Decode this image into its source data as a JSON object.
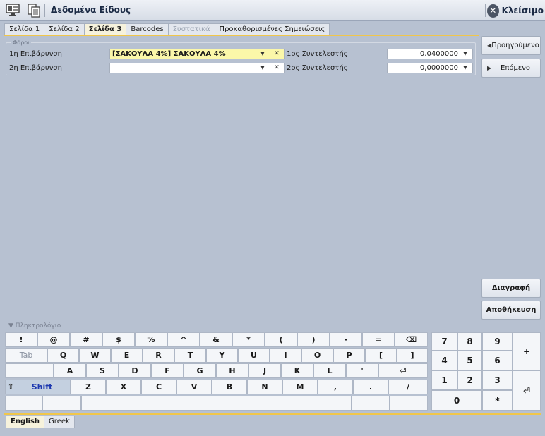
{
  "header": {
    "title": "Δεδομένα Είδους",
    "close_label": "Κλείσιμο"
  },
  "tabs": [
    {
      "label": "Σελίδα 1",
      "active": false,
      "disabled": false
    },
    {
      "label": "Σελίδα 2",
      "active": false,
      "disabled": false
    },
    {
      "label": "Σελίδα 3",
      "active": true,
      "disabled": false
    },
    {
      "label": "Barcodes",
      "active": false,
      "disabled": false
    },
    {
      "label": "Συστατικά",
      "active": false,
      "disabled": true
    },
    {
      "label": "Προκαθορισμένες Σημειώσεις",
      "active": false,
      "disabled": false
    }
  ],
  "taxes": {
    "legend": "Φόροι",
    "charge1_label": "1η Επιβάρυνση",
    "charge1_value": "[ΣΑΚΟΥΛΑ 4%] ΣΑΚΟΥΛΑ 4%",
    "charge2_label": "2η Επιβάρυνση",
    "charge2_value": "",
    "factor1_label": "1ος Συντελεστής",
    "factor1_value": "0,0400000",
    "factor2_label": "2ος Συντελεστής",
    "factor2_value": "0,0000000"
  },
  "side": {
    "prev_label": "Προηγούμενο",
    "next_label": "Επόμενο",
    "delete_label": "Διαγραφή",
    "save_label": "Αποθήκευση"
  },
  "keyboard": {
    "legend": "Πληκτρολόγιο",
    "row1": [
      "!",
      "@",
      "#",
      "$",
      "%",
      "^",
      "&",
      "*",
      "(",
      ")",
      "-",
      "=",
      "⌫"
    ],
    "row2": [
      "Tab",
      "Q",
      "W",
      "E",
      "R",
      "T",
      "Y",
      "U",
      "I",
      "O",
      "P",
      "[",
      "]"
    ],
    "row3": [
      "",
      "A",
      "S",
      "D",
      "F",
      "G",
      "H",
      "J",
      "K",
      "L",
      "'",
      "⏎"
    ],
    "row4_shift": "Shift",
    "row4_shift_icon": "⇧",
    "row4": [
      "Z",
      "X",
      "C",
      "V",
      "B",
      "N",
      "M",
      ",",
      ".",
      "/"
    ],
    "numpad": {
      "r1": [
        "7",
        "8",
        "9"
      ],
      "r2": [
        "4",
        "5",
        "6"
      ],
      "r3": [
        "1",
        "2",
        "3"
      ],
      "zero": "0",
      "star": "*",
      "plus": "+",
      "enter": "⏎"
    }
  },
  "languages": [
    {
      "label": "English",
      "active": true
    },
    {
      "label": "Greek",
      "active": false
    }
  ]
}
